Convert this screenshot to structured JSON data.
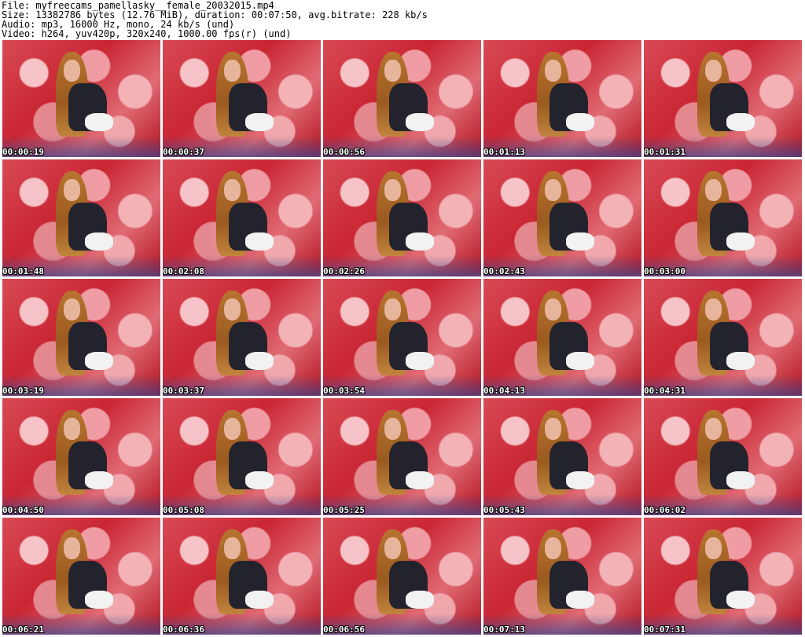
{
  "header": {
    "file_line": "File: myfreecams_pamellasky__female_20032015.mp4",
    "size_line": "Size: 13382786 bytes (12.76 MiB), duration: 00:07:50, avg.bitrate: 228 kb/s",
    "audio_line": "Audio: mp3, 16000 Hz, mono, 24 kb/s (und)",
    "video_line": "Video: h264, yuv420p, 320x240, 1000.00 fps(r) (und)"
  },
  "thumbnails": [
    {
      "timestamp": "00:00:19"
    },
    {
      "timestamp": "00:00:37"
    },
    {
      "timestamp": "00:00:56"
    },
    {
      "timestamp": "00:01:13"
    },
    {
      "timestamp": "00:01:31"
    },
    {
      "timestamp": "00:01:48"
    },
    {
      "timestamp": "00:02:08"
    },
    {
      "timestamp": "00:02:26"
    },
    {
      "timestamp": "00:02:43"
    },
    {
      "timestamp": "00:03:00"
    },
    {
      "timestamp": "00:03:19"
    },
    {
      "timestamp": "00:03:37"
    },
    {
      "timestamp": "00:03:54"
    },
    {
      "timestamp": "00:04:13"
    },
    {
      "timestamp": "00:04:31"
    },
    {
      "timestamp": "00:04:50"
    },
    {
      "timestamp": "00:05:08"
    },
    {
      "timestamp": "00:05:25"
    },
    {
      "timestamp": "00:05:43"
    },
    {
      "timestamp": "00:06:02"
    },
    {
      "timestamp": "00:06:21"
    },
    {
      "timestamp": "00:06:36"
    },
    {
      "timestamp": "00:06:56"
    },
    {
      "timestamp": "00:07:13"
    },
    {
      "timestamp": "00:07:31"
    }
  ]
}
